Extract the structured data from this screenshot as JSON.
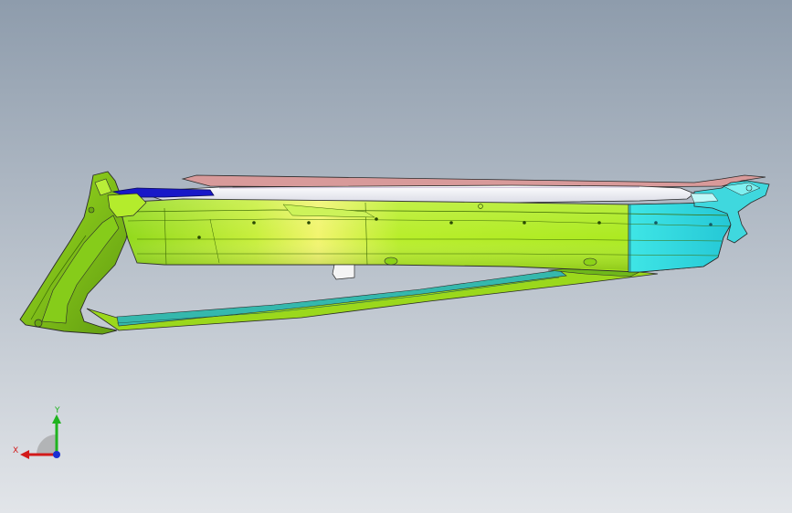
{
  "viewport": {
    "background_top": "#8e9cac",
    "background_bottom": "#e2e5e9"
  },
  "model": {
    "colors": {
      "green_body": "#a6e81c",
      "green_dark": "#5f9a10",
      "yellow_highlight": "#f2f56e",
      "cyan_end": "#31d9e0",
      "cyan_dark": "#1ca3b3",
      "white_rail": "#f2f2f4",
      "pink_rail": "#d89a9a",
      "blue_part": "#1818c8",
      "teal_strip": "#35b8ad",
      "edge": "#2a2a2a"
    }
  },
  "triad": {
    "x_label": "X",
    "y_label": "Y",
    "x_color": "#d21a1a",
    "y_color": "#1fb31f",
    "z_color": "#1a2fd2"
  }
}
